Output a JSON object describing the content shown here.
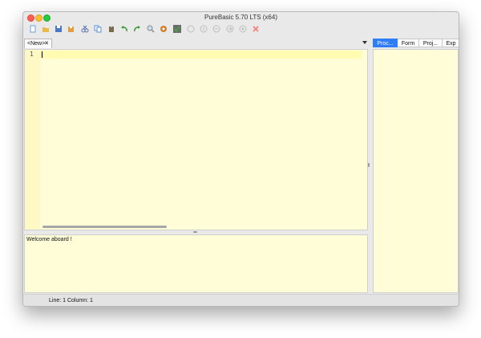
{
  "window": {
    "title": "PureBasic 5.70 LTS (x64)"
  },
  "toolbar": {
    "items": [
      {
        "name": "new-file-button",
        "icon": "new-file-icon",
        "color": "#6aa0e8"
      },
      {
        "name": "open-file-button",
        "icon": "open-folder-icon",
        "color": "#e9b94a"
      },
      {
        "name": "save-button",
        "icon": "save-icon",
        "color": "#4a78c8"
      },
      {
        "name": "save-as-button",
        "icon": "save-as-icon",
        "color": "#e0a040"
      },
      {
        "name": "cut-button",
        "icon": "scissors-icon",
        "color": "#5a6fb0"
      },
      {
        "name": "copy-button",
        "icon": "copy-icon",
        "color": "#5a8fd8"
      },
      {
        "name": "paste-button",
        "icon": "paste-icon",
        "color": "#7a6a50"
      },
      {
        "name": "undo-button",
        "icon": "undo-icon",
        "color": "#3a9a3a"
      },
      {
        "name": "redo-button",
        "icon": "redo-icon",
        "color": "#3a9a3a"
      },
      {
        "name": "find-button",
        "icon": "find-icon",
        "color": "#8a8a8a"
      },
      {
        "name": "compile-run-button",
        "icon": "compile-icon",
        "color": "#d08030"
      },
      {
        "name": "debugger-button",
        "icon": "debugger-icon",
        "color": "#4aa04a"
      },
      {
        "name": "stop-button",
        "icon": "stop-icon",
        "color": "#bdbdbd"
      },
      {
        "name": "step-button",
        "icon": "step-icon",
        "color": "#bdbdbd"
      },
      {
        "name": "step-over-button",
        "icon": "step-over-icon",
        "color": "#bdbdbd"
      },
      {
        "name": "step-out-button",
        "icon": "step-out-icon",
        "color": "#bdbdbd"
      },
      {
        "name": "continue-button",
        "icon": "continue-icon",
        "color": "#bdbdbd"
      },
      {
        "name": "kill-button",
        "icon": "kill-icon",
        "color": "#f08a8a"
      }
    ]
  },
  "editor": {
    "tab_label": "<New>",
    "tab_close": "✕",
    "line_number": "1"
  },
  "output": {
    "message": "Welcome aboard !"
  },
  "side_panel": {
    "tabs": [
      {
        "label": "Proc...",
        "active": true
      },
      {
        "label": "Form",
        "active": false
      },
      {
        "label": "Proj...",
        "active": false
      },
      {
        "label": "Exp",
        "active": false
      }
    ]
  },
  "status": {
    "text": "Line: 1   Column: 1"
  },
  "colors": {
    "editor_bg": "#fefdd8",
    "active_tab": "#2f7df7"
  }
}
